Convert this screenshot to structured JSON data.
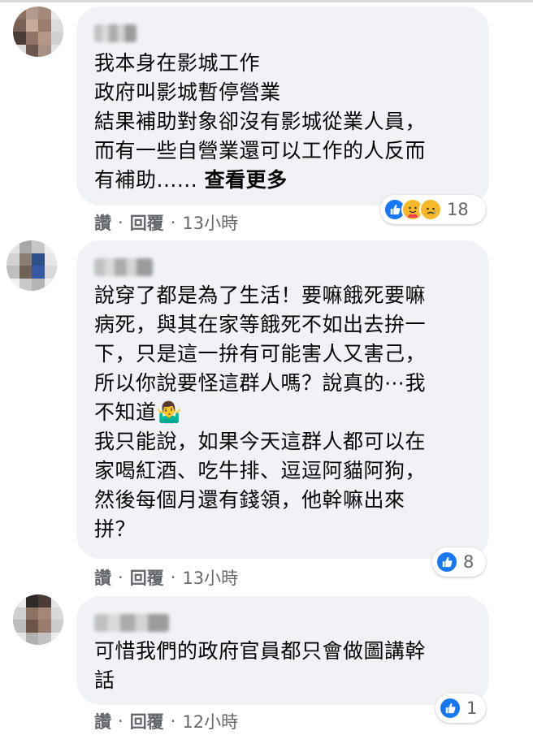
{
  "comments": [
    {
      "lines": [
        "我本身在影城工作",
        "政府叫影城暫停營業",
        "結果補助對象卻沒有影城從業人員，",
        "而有一些自營業還可以工作的人反而"
      ],
      "last_line_text": "有補助......",
      "see_more": "查看更多",
      "reactions": {
        "icons": [
          "like-icon",
          "care-icon",
          "sad-icon"
        ],
        "count": "18"
      },
      "actions": {
        "like": "讚",
        "reply": "回覆",
        "time": "13小時",
        "separator": "·"
      }
    },
    {
      "text": "說穿了都是為了生活！要嘛餓死要嘛\n病死，與其在家等餓死不如出去拚一\n下，只是這一拚有可能害人又害己，\n所以你說要怪這群人嗎？說真的⋯我\n不知道🤷‍♂️\n我只能說，如果今天這群人都可以在\n家喝紅酒、吃牛排、逗逗阿貓阿狗，\n然後每個月還有錢領，他幹嘛出來\n拼？",
      "reactions": {
        "icons": [
          "like-icon"
        ],
        "count": "8"
      },
      "actions": {
        "like": "讚",
        "reply": "回覆",
        "time": "13小時",
        "separator": "·"
      }
    },
    {
      "text": "可惜我們的政府官員都只會做圖講幹\n話",
      "reactions": {
        "icons": [
          "like-icon"
        ],
        "count": "1"
      },
      "actions": {
        "like": "讚",
        "reply": "回覆",
        "time": "12小時",
        "separator": "·"
      }
    }
  ],
  "colors": {
    "bubble": "#f0f2f5",
    "like": "#1877f2",
    "meta": "#65676b"
  }
}
